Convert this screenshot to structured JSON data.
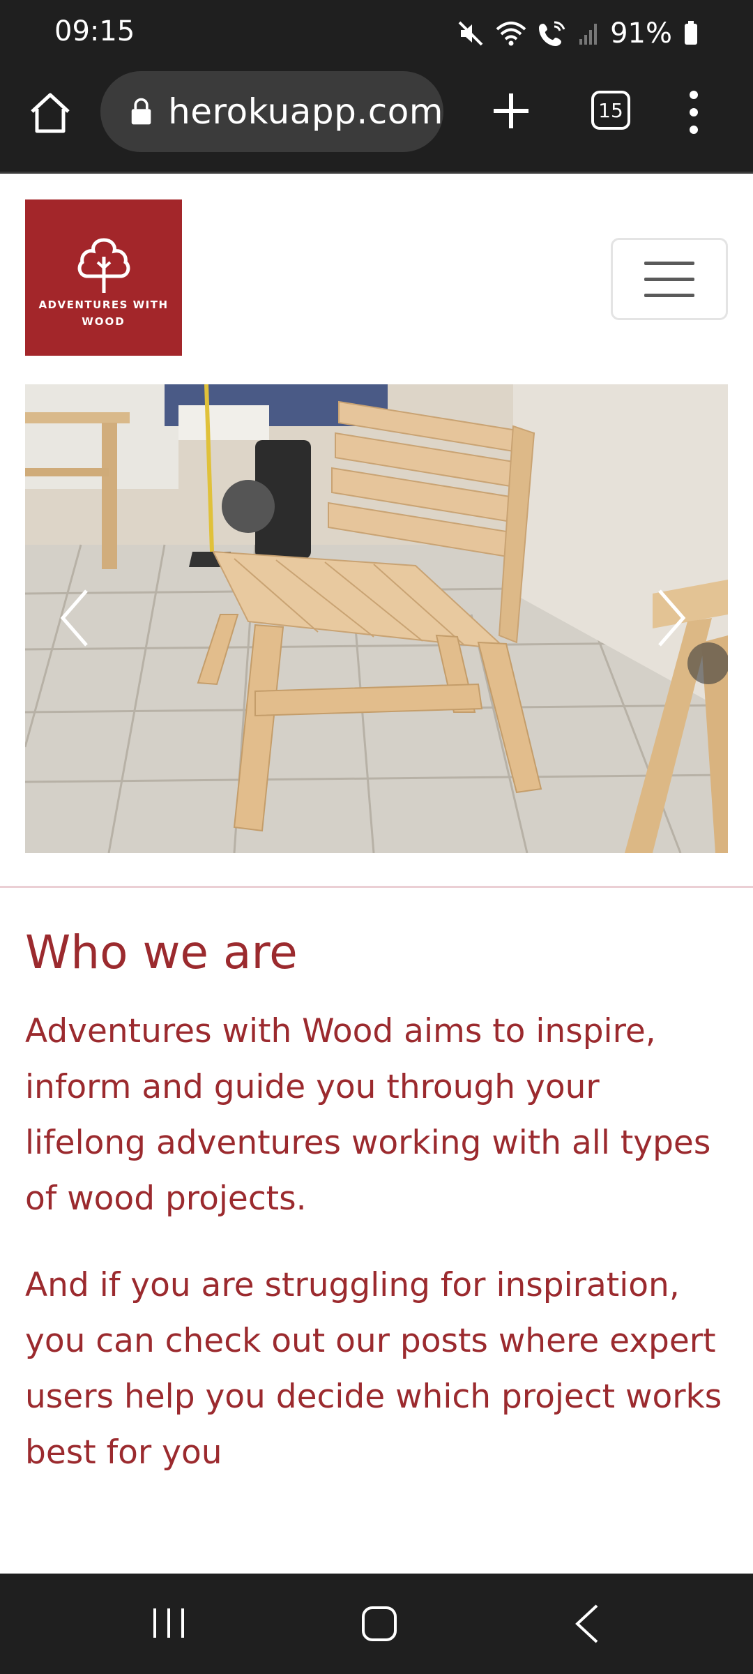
{
  "status_bar": {
    "time": "09:15",
    "battery": "91%"
  },
  "browser": {
    "url": "herokuapp.com",
    "tab_count": "15"
  },
  "site": {
    "logo_line1": "ADVENTURES WITH",
    "logo_line2": "WOOD",
    "brand_color": "#a3262a",
    "text_color": "#9b2a2e"
  },
  "about": {
    "title": "Who we are",
    "paragraph1": "Adventures with Wood aims to inspire, inform and guide you through your lifelong adventures working with all types of wood projects.",
    "paragraph2": "And if you are struggling for inspiration, you can check out our posts where expert users help you decide which project works best for you"
  },
  "icons": {
    "home": "home-icon",
    "lock": "lock-icon",
    "new_tab": "plus-icon",
    "menu": "more-vert-icon",
    "carousel_prev": "chevron-left-icon",
    "carousel_next": "chevron-right-icon"
  }
}
